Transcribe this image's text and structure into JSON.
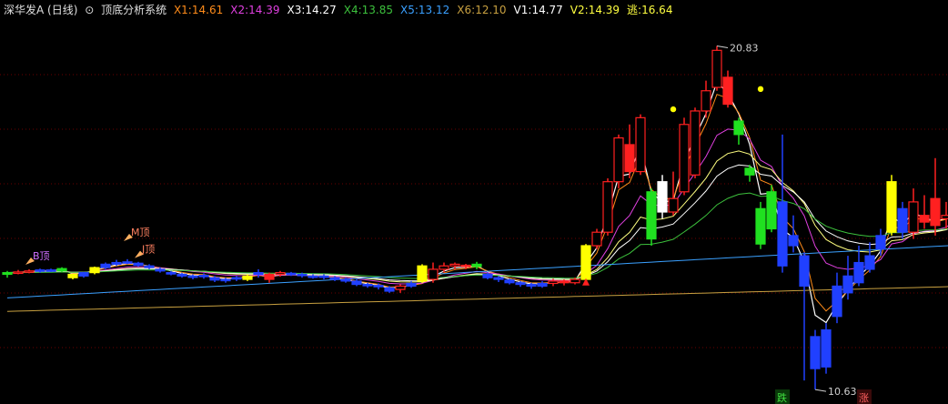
{
  "header": {
    "title": "深华发A (日线)",
    "system": "顶底分析系统",
    "indicators": [
      {
        "label": "X1:",
        "value": "14.61",
        "color": "#ff8c1a"
      },
      {
        "label": "X2:",
        "value": "14.39",
        "color": "#e040e0"
      },
      {
        "label": "X3:",
        "value": "14.27",
        "color": "#ffffff"
      },
      {
        "label": "X4:",
        "value": "13.85",
        "color": "#3cc03c"
      },
      {
        "label": "X5:",
        "value": "13.12",
        "color": "#3aa0ff"
      },
      {
        "label": "X6:",
        "value": "12.10",
        "color": "#c8a040"
      },
      {
        "label": "V1:",
        "value": "14.77",
        "color": "#ffffff"
      },
      {
        "label": "V2:",
        "value": "14.39",
        "color": "#ffff40"
      },
      {
        "label": "逃:",
        "value": "16.64",
        "color": "#ffff40"
      }
    ]
  },
  "chart_data": {
    "type": "candlestick",
    "ylim": [
      10.2,
      21.6
    ],
    "grid": "horizontal dotted",
    "annotations": {
      "high_label": "20.83",
      "low_label": "10.63",
      "tag_b": "B顶",
      "tag_m": "M顶",
      "tag_j": "J顶",
      "sig_down": "跌",
      "sig_up": "涨"
    },
    "colors": {
      "up": "#ff2020",
      "down": "#2040ff",
      "yellow": "#ffff00",
      "white": "#ffffff",
      "green": "#20e020"
    },
    "candles": [
      [
        14.05,
        14.1,
        13.95,
        14.15,
        "g"
      ],
      [
        14.1,
        14.12,
        14.05,
        14.18,
        "u"
      ],
      [
        14.12,
        14.15,
        14.08,
        14.2,
        "u"
      ],
      [
        14.15,
        14.18,
        14.1,
        14.22,
        "b"
      ],
      [
        14.18,
        14.16,
        14.12,
        14.22,
        "b"
      ],
      [
        14.16,
        14.22,
        14.12,
        14.26,
        "g"
      ],
      [
        14.05,
        13.95,
        13.9,
        14.05,
        "y"
      ],
      [
        14.0,
        14.1,
        13.95,
        14.12,
        "b"
      ],
      [
        14.1,
        14.25,
        14.05,
        14.28,
        "y"
      ],
      [
        14.25,
        14.35,
        14.2,
        14.4,
        "b"
      ],
      [
        14.35,
        14.4,
        14.3,
        14.48,
        "b"
      ],
      [
        14.4,
        14.42,
        14.35,
        14.5,
        "b"
      ],
      [
        14.38,
        14.32,
        14.28,
        14.42,
        "b"
      ],
      [
        14.3,
        14.25,
        14.2,
        14.35,
        "b"
      ],
      [
        14.2,
        14.15,
        14.1,
        14.25,
        "b"
      ],
      [
        14.1,
        14.08,
        14.02,
        14.15,
        "b"
      ],
      [
        14.05,
        14.0,
        13.95,
        14.1,
        "b"
      ],
      [
        14.0,
        13.98,
        13.9,
        14.05,
        "b"
      ],
      [
        13.98,
        14.02,
        13.92,
        14.08,
        "b"
      ],
      [
        13.95,
        13.88,
        13.82,
        14.0,
        "b"
      ],
      [
        13.88,
        13.9,
        13.8,
        13.95,
        "b"
      ],
      [
        13.92,
        13.95,
        13.85,
        14.0,
        "b"
      ],
      [
        13.9,
        14.0,
        13.85,
        14.05,
        "y"
      ],
      [
        14.05,
        14.1,
        13.95,
        14.2,
        "b"
      ],
      [
        14.05,
        13.9,
        13.8,
        14.1,
        "u"
      ],
      [
        14.05,
        14.1,
        13.98,
        14.15,
        "u"
      ],
      [
        14.08,
        14.05,
        14.0,
        14.12,
        "b"
      ],
      [
        14.05,
        14.02,
        13.95,
        14.1,
        "b"
      ],
      [
        14.0,
        13.98,
        13.92,
        14.05,
        "b"
      ],
      [
        13.98,
        14.0,
        13.9,
        14.05,
        "b"
      ],
      [
        13.95,
        13.9,
        13.85,
        14.0,
        "b"
      ],
      [
        13.9,
        13.85,
        13.8,
        13.95,
        "b"
      ],
      [
        13.85,
        13.75,
        13.7,
        13.9,
        "b"
      ],
      [
        13.75,
        13.72,
        13.65,
        13.8,
        "b"
      ],
      [
        13.72,
        13.68,
        13.6,
        13.78,
        "b"
      ],
      [
        13.65,
        13.55,
        13.5,
        13.7,
        "b"
      ],
      [
        13.6,
        13.7,
        13.5,
        13.75,
        "u"
      ],
      [
        13.7,
        13.78,
        13.65,
        13.85,
        "b"
      ],
      [
        14.3,
        13.85,
        13.8,
        14.35,
        "y"
      ],
      [
        13.9,
        14.2,
        13.8,
        14.4,
        "u"
      ],
      [
        14.2,
        14.3,
        14.1,
        14.4,
        "u"
      ],
      [
        14.3,
        14.35,
        14.2,
        14.4,
        "u"
      ],
      [
        14.32,
        14.28,
        14.2,
        14.36,
        "u"
      ],
      [
        14.28,
        14.35,
        14.2,
        14.42,
        "g"
      ],
      [
        14.05,
        13.95,
        13.9,
        14.1,
        "b"
      ],
      [
        13.95,
        13.9,
        13.82,
        14.0,
        "b"
      ],
      [
        13.88,
        13.8,
        13.75,
        13.92,
        "b"
      ],
      [
        13.8,
        13.75,
        13.68,
        13.85,
        "b"
      ],
      [
        13.75,
        13.7,
        13.62,
        13.8,
        "b"
      ],
      [
        13.7,
        13.78,
        13.65,
        13.85,
        "b"
      ],
      [
        13.78,
        13.85,
        13.7,
        13.92,
        "u"
      ],
      [
        13.85,
        13.8,
        13.72,
        13.9,
        "u"
      ],
      [
        13.8,
        13.9,
        13.75,
        13.95,
        "u"
      ],
      [
        13.9,
        14.9,
        13.85,
        14.95,
        "y"
      ],
      [
        14.9,
        15.3,
        14.8,
        15.4,
        "u"
      ],
      [
        15.3,
        16.8,
        15.2,
        16.9,
        "u"
      ],
      [
        16.8,
        18.1,
        16.6,
        18.2,
        "u"
      ],
      [
        17.9,
        17.1,
        16.9,
        18.5,
        "u"
      ],
      [
        17.1,
        18.7,
        17.0,
        18.8,
        "u"
      ],
      [
        16.5,
        15.1,
        14.9,
        16.6,
        "g"
      ],
      [
        16.8,
        15.9,
        15.7,
        17.0,
        "w"
      ],
      [
        15.9,
        16.3,
        15.8,
        17.1,
        "u"
      ],
      [
        16.5,
        18.5,
        16.4,
        18.7,
        "u"
      ],
      [
        17.0,
        18.9,
        16.9,
        19.0,
        "u"
      ],
      [
        18.9,
        19.5,
        18.7,
        19.8,
        "u"
      ],
      [
        19.6,
        20.7,
        19.5,
        20.83,
        "u"
      ],
      [
        19.9,
        19.1,
        19.0,
        20.1,
        "u"
      ],
      [
        18.6,
        18.2,
        17.9,
        18.7,
        "g"
      ],
      [
        17.2,
        17.0,
        16.8,
        17.3,
        "g"
      ],
      [
        16.0,
        14.95,
        14.8,
        16.2,
        "g"
      ],
      [
        15.4,
        16.5,
        15.3,
        16.7,
        "g"
      ],
      [
        16.2,
        14.3,
        14.1,
        18.2,
        "b"
      ],
      [
        15.2,
        14.9,
        14.7,
        15.8,
        "b"
      ],
      [
        14.6,
        13.7,
        10.9,
        14.7,
        "b"
      ],
      [
        12.2,
        11.25,
        10.63,
        12.4,
        "b"
      ],
      [
        11.3,
        12.4,
        11.1,
        12.6,
        "b"
      ],
      [
        12.8,
        13.7,
        12.6,
        14.1,
        "b"
      ],
      [
        13.5,
        14.0,
        13.3,
        14.6,
        "b"
      ],
      [
        13.8,
        14.4,
        13.7,
        14.9,
        "b"
      ],
      [
        14.2,
        14.6,
        14.1,
        15.0,
        "b"
      ],
      [
        14.8,
        15.2,
        14.6,
        15.4,
        "b"
      ],
      [
        15.3,
        16.8,
        15.2,
        17.0,
        "y"
      ],
      [
        16.0,
        15.3,
        15.1,
        16.2,
        "b"
      ],
      [
        15.3,
        16.2,
        15.1,
        16.6,
        "u"
      ],
      [
        15.8,
        15.6,
        15.4,
        16.4,
        "u"
      ],
      [
        16.3,
        15.5,
        15.2,
        17.5,
        "u"
      ],
      [
        15.7,
        15.8,
        15.4,
        16.2,
        "u"
      ],
      [
        15.9,
        16.6,
        15.8,
        17.2,
        "w"
      ]
    ]
  }
}
